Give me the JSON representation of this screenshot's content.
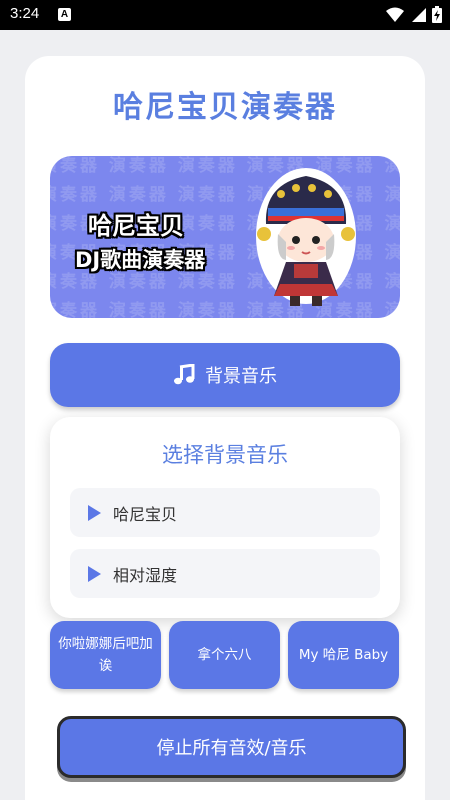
{
  "status_bar": {
    "time": "3:24",
    "notification_badge": "A"
  },
  "app": {
    "title": "哈尼宝贝演奏器"
  },
  "banner": {
    "line1": "哈尼宝贝",
    "line2": "DJ歌曲演奏器",
    "pattern_text": "演奏器 演奏器 演奏器 演奏器 演奏器 演奏器"
  },
  "bgm_button": {
    "icon": "music-note-icon",
    "label": "背景音乐"
  },
  "bgm_panel": {
    "title": "选择背景音乐",
    "items": [
      {
        "label": "哈尼宝贝",
        "icon": "play-icon"
      },
      {
        "label": "相对湿度",
        "icon": "play-icon"
      }
    ]
  },
  "sound_buttons": [
    {
      "label": "你啦娜娜后吧加诶"
    },
    {
      "label": "拿个六八"
    },
    {
      "label": "My 哈尼 Baby"
    }
  ],
  "stop_button": {
    "label": "停止所有音效/音乐"
  },
  "colors": {
    "accent": "#5b77e6",
    "title": "#5a7fe0",
    "banner_bg": "#7c87ee"
  }
}
